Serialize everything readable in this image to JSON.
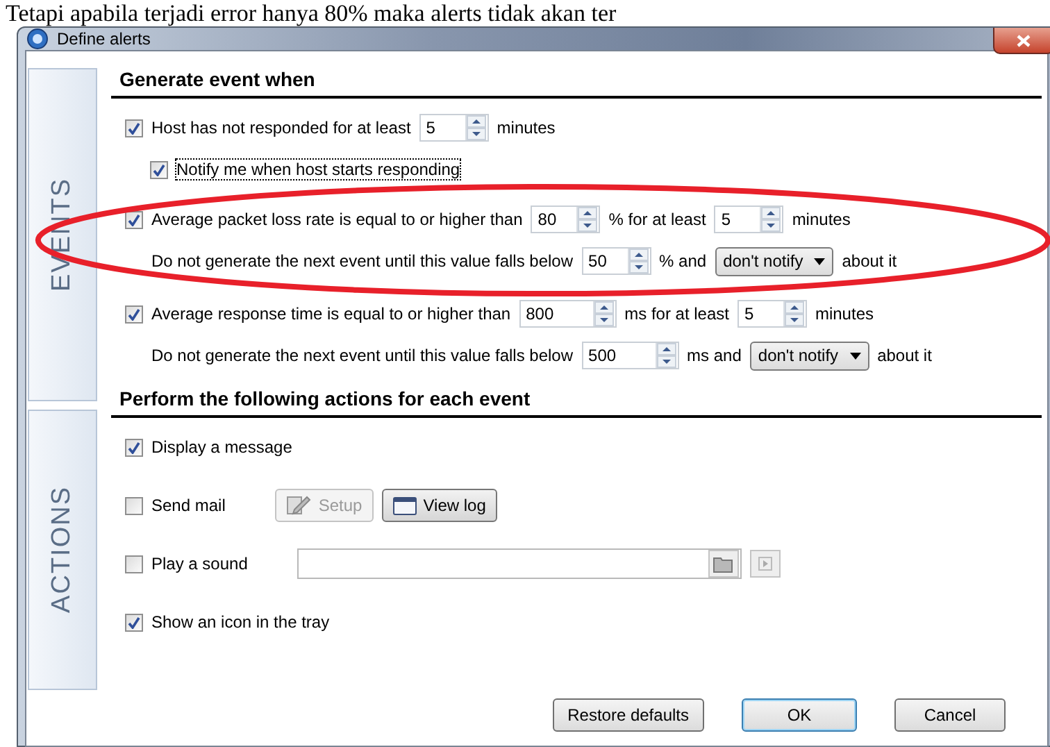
{
  "caption": "Tetapi apabila terjadi error hanya 80% maka alerts tidak akan ter",
  "window": {
    "title": "Define alerts"
  },
  "tabs": [
    {
      "label": "EVENTS"
    },
    {
      "label": "ACTIONS"
    }
  ],
  "events": {
    "heading": "Generate event when",
    "rows": [
      {
        "kind": "check",
        "checked": true,
        "items": [
          {
            "kind": "text",
            "text": "Host has not responded for at least"
          },
          {
            "kind": "spin",
            "value": "5"
          },
          {
            "kind": "text",
            "text": "minutes"
          }
        ]
      },
      {
        "kind": "subcheck",
        "checked": true,
        "focused": true,
        "items": [
          {
            "kind": "text",
            "text": "Notify me when host starts responding"
          }
        ]
      },
      {
        "kind": "check",
        "checked": true,
        "items": [
          {
            "kind": "text",
            "text": "Average packet loss rate is equal to or higher than"
          },
          {
            "kind": "spin",
            "value": "80"
          },
          {
            "kind": "text",
            "text": "% for at least"
          },
          {
            "kind": "spin",
            "value": "5"
          },
          {
            "kind": "text",
            "text": "minutes"
          }
        ]
      },
      {
        "kind": "plain",
        "items": [
          {
            "kind": "text",
            "text": "Do not generate the next event until this value falls below"
          },
          {
            "kind": "spin",
            "value": "50"
          },
          {
            "kind": "text",
            "text": "% and"
          },
          {
            "kind": "select",
            "value": "don't notify"
          },
          {
            "kind": "text",
            "text": "about it"
          }
        ]
      },
      {
        "kind": "check",
        "checked": true,
        "items": [
          {
            "kind": "text",
            "text": "Average response time is equal to or higher than"
          },
          {
            "kind": "spin",
            "value": "800"
          },
          {
            "kind": "text",
            "text": "ms for at least"
          },
          {
            "kind": "spin",
            "value": "5"
          },
          {
            "kind": "text",
            "text": "minutes"
          }
        ]
      },
      {
        "kind": "plain",
        "items": [
          {
            "kind": "text",
            "text": "Do not generate the next event until this value falls below"
          },
          {
            "kind": "spin",
            "value": "500"
          },
          {
            "kind": "text",
            "text": "ms and"
          },
          {
            "kind": "select",
            "value": "don't notify"
          },
          {
            "kind": "text",
            "text": "about it"
          }
        ]
      }
    ]
  },
  "actions": {
    "heading": "Perform the following actions for each event",
    "rows": [
      {
        "kind": "check",
        "checked": true,
        "items": [
          {
            "kind": "text",
            "text": "Display a message"
          }
        ]
      },
      {
        "kind": "check",
        "checked": false,
        "items": [
          {
            "kind": "text",
            "text": "Send mail"
          },
          {
            "kind": "button",
            "label": "Setup",
            "disabled": true
          },
          {
            "kind": "button",
            "label": "View log",
            "disabled": false
          }
        ]
      },
      {
        "kind": "check",
        "checked": false,
        "items": [
          {
            "kind": "text",
            "text": "Play a sound"
          },
          {
            "kind": "file"
          }
        ]
      },
      {
        "kind": "check",
        "checked": true,
        "items": [
          {
            "kind": "text",
            "text": "Show an icon in the tray"
          }
        ]
      }
    ]
  },
  "buttons": [
    {
      "label": "Restore defaults",
      "default": false
    },
    {
      "label": "OK",
      "default": true
    },
    {
      "label": "Cancel",
      "default": false
    }
  ]
}
